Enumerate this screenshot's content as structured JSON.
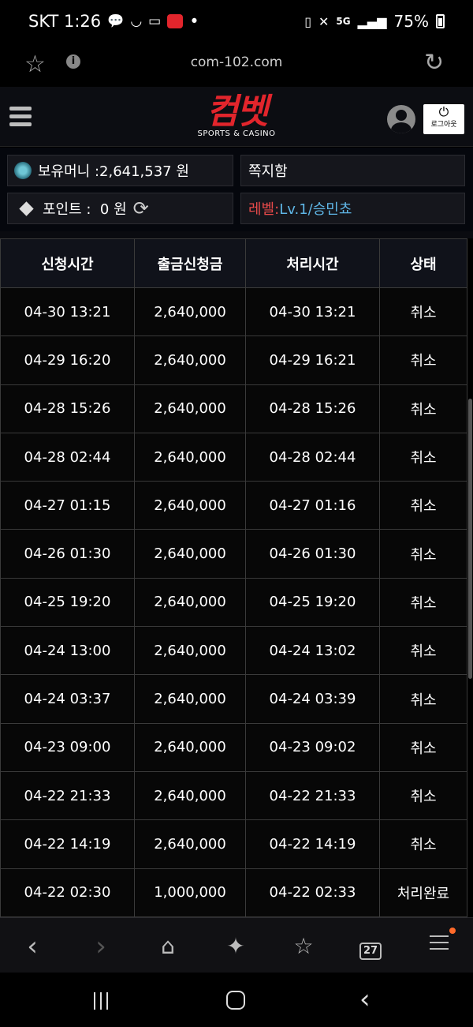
{
  "status_bar": {
    "carrier_time": "SKT 1:26",
    "dot": "•",
    "network": "5G",
    "battery": "75%"
  },
  "browser": {
    "url": "com-102.com"
  },
  "header": {
    "logo_text": "컴벳",
    "logo_sub": "SPORTS & CASINO",
    "logout_label": "로그아웃"
  },
  "info": {
    "money": "보유머니 :2,641,537 원",
    "messages": "쪽지함",
    "points": "포인트 :  0 원",
    "level_label": "레벨:",
    "level_value": "Lv.1/승민쵸"
  },
  "table": {
    "headers": [
      "신청시간",
      "출금신청금",
      "처리시간",
      "상태"
    ],
    "rows": [
      [
        "04-30 13:21",
        "2,640,000",
        "04-30 13:21",
        "취소"
      ],
      [
        "04-29 16:20",
        "2,640,000",
        "04-29 16:21",
        "취소"
      ],
      [
        "04-28 15:26",
        "2,640,000",
        "04-28 15:26",
        "취소"
      ],
      [
        "04-28 02:44",
        "2,640,000",
        "04-28 02:44",
        "취소"
      ],
      [
        "04-27 01:15",
        "2,640,000",
        "04-27 01:16",
        "취소"
      ],
      [
        "04-26 01:30",
        "2,640,000",
        "04-26 01:30",
        "취소"
      ],
      [
        "04-25 19:20",
        "2,640,000",
        "04-25 19:20",
        "취소"
      ],
      [
        "04-24 13:00",
        "2,640,000",
        "04-24 13:02",
        "취소"
      ],
      [
        "04-24 03:37",
        "2,640,000",
        "04-24 03:39",
        "취소"
      ],
      [
        "04-23 09:00",
        "2,640,000",
        "04-23 09:02",
        "취소"
      ],
      [
        "04-22 21:33",
        "2,640,000",
        "04-22 21:33",
        "취소"
      ],
      [
        "04-22 14:19",
        "2,640,000",
        "04-22 14:19",
        "취소"
      ],
      [
        "04-22 02:30",
        "1,000,000",
        "04-22 02:33",
        "처리완료"
      ]
    ]
  },
  "browser_nav": {
    "tab_count": "27"
  },
  "colors": {
    "brand_red": "#e2252c",
    "level_red": "#e84a4a",
    "level_blue": "#5fb6e6",
    "notification_dot": "#ff6a2a"
  },
  "icons": {
    "status": [
      "chat-icon",
      "smile-icon",
      "card-icon",
      "app-badge-icon",
      "battery-saver-icon",
      "mute-icon",
      "signal-icon",
      "battery-icon"
    ],
    "browser": [
      "star-icon",
      "info-icon",
      "reload-icon"
    ],
    "header": [
      "hamburger-icon",
      "user-avatar-icon",
      "power-icon"
    ],
    "info": [
      "coin-icon",
      "diamond-icon",
      "refresh-icon"
    ],
    "nav": [
      "back-icon",
      "forward-icon",
      "home-icon",
      "sparkle-icon",
      "bookmark-icon",
      "tabs-icon",
      "menu-icon"
    ]
  }
}
